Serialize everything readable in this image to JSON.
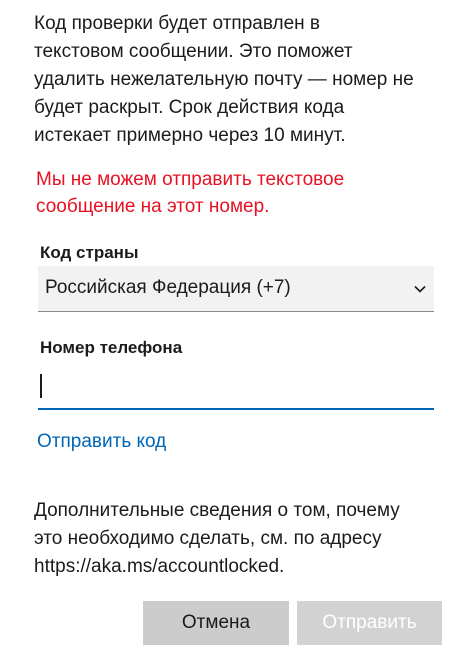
{
  "intro": {
    "lines": [
      "Код проверки будет отправлен в",
      "текстовом сообщении. Это поможет",
      "удалить нежелательную почту — номер не",
      "будет раскрыт. Срок действия кода",
      "истекает примерно через 10 минут."
    ]
  },
  "error": {
    "lines": [
      "Мы не можем отправить текстовое",
      "сообщение на этот номер."
    ],
    "color": "#e81123"
  },
  "country": {
    "label": "Код страны",
    "selected": "Российская Федерация (+7)",
    "icon": "chevron-down-icon"
  },
  "phone": {
    "label": "Номер телефона",
    "value": ""
  },
  "send_code_link": "Отправить код",
  "info": {
    "lines": [
      "Дополнительные сведения о том, почему",
      "это необходимо сделать, см. по адресу",
      "https://aka.ms/accountlocked."
    ]
  },
  "buttons": {
    "cancel": "Отмена",
    "submit": "Отправить"
  },
  "colors": {
    "accent": "#0067b8",
    "error": "#e81123",
    "button_bg": "#cccccc"
  }
}
